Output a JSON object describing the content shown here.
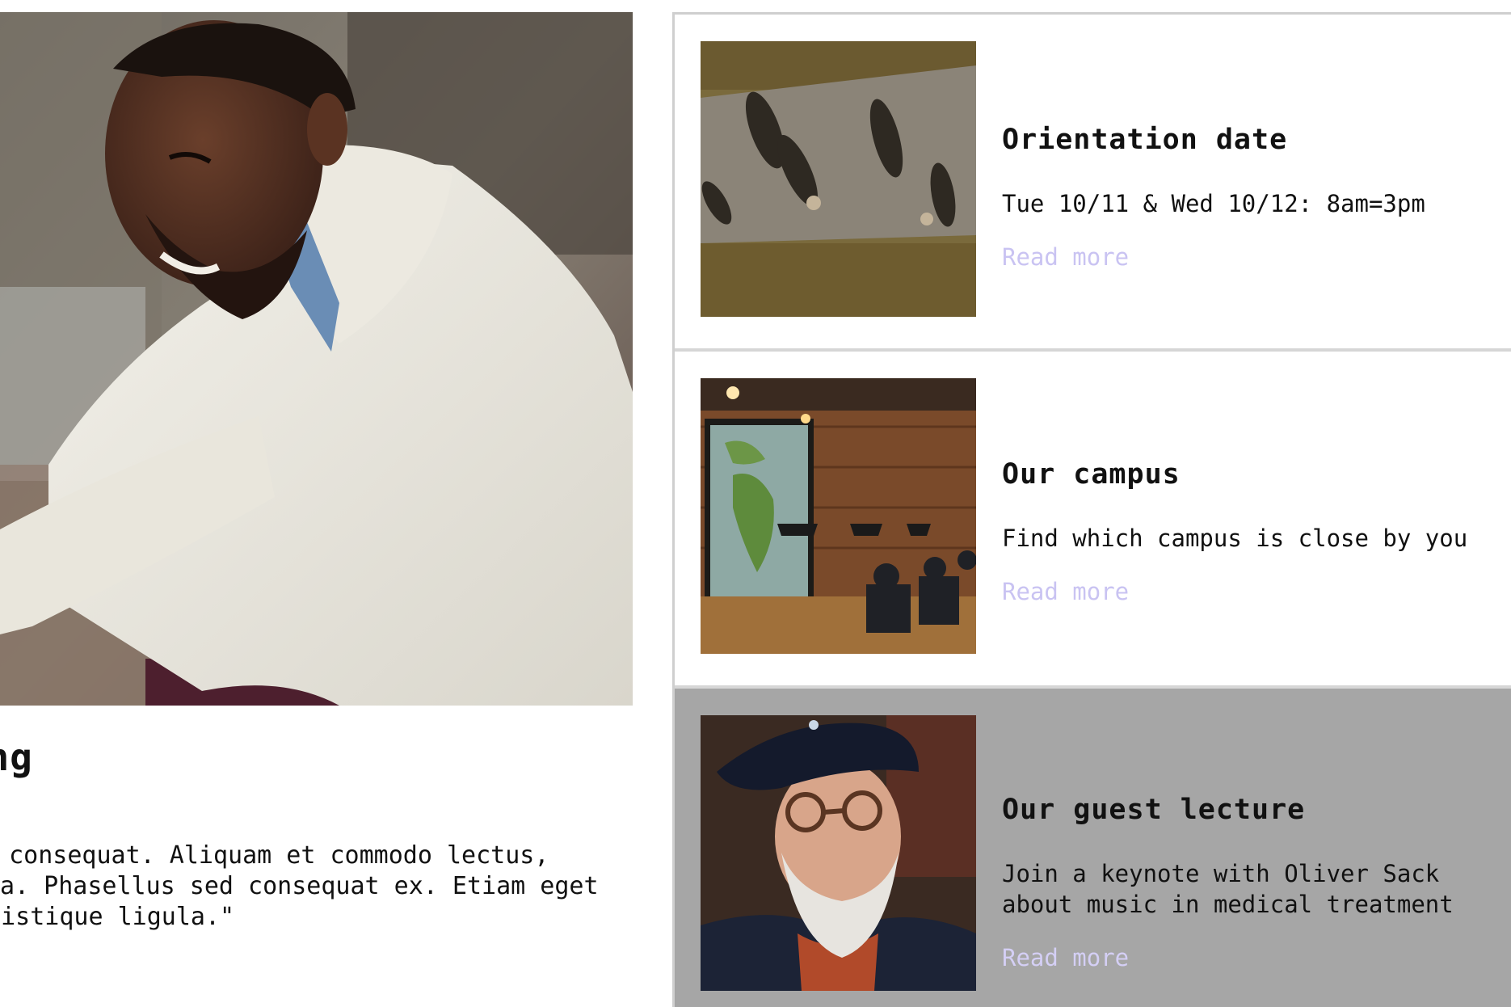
{
  "feature": {
    "photo_alt": "smiling man in white knit sweater",
    "title": "eticing",
    "quote_lines": [
      "r consequat. Aliquam et commodo lectus,",
      "a. Phasellus sed consequat ex. Etiam eget",
      "tristique ligula.\""
    ]
  },
  "news": [
    {
      "title": "Orientation date",
      "text": "Tue 10/11 & Wed 10/12: 8am=3pm",
      "link": "Read more",
      "thumb_icon": "aerial-walkers-photo"
    },
    {
      "title": "Our campus",
      "text": "Find which campus is close by you",
      "link": "Read more",
      "thumb_icon": "cafe-map-photo"
    },
    {
      "title": "Our guest lecture",
      "text": "Join a keynote with Oliver Sack about music in medical treatment",
      "link": "Read more",
      "thumb_icon": "elderly-man-beret-photo"
    }
  ],
  "colors": {
    "link": "#c9c3f2",
    "highlight_card_bg": "#a6a6a6",
    "divider": "#d6d6d6"
  }
}
